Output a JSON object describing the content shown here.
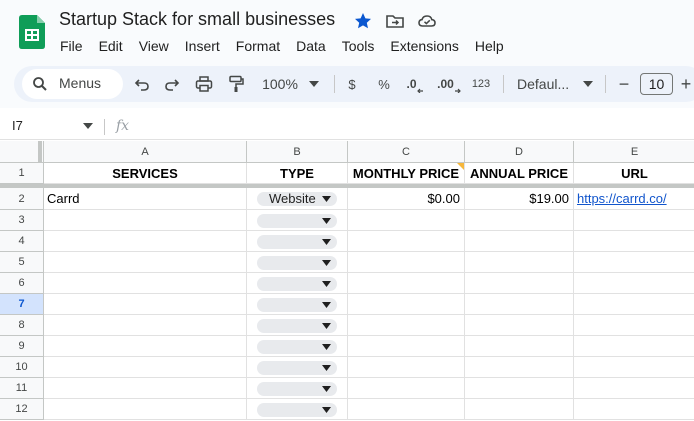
{
  "window": {
    "title": "Startup Stack for small businesses"
  },
  "menubar": {
    "items": [
      "File",
      "Edit",
      "View",
      "Insert",
      "Format",
      "Data",
      "Tools",
      "Extensions",
      "Help"
    ]
  },
  "toolbar": {
    "menus_label": "Menus",
    "zoom": "100%",
    "currency": "$",
    "percent": "%",
    "decrease_decimal": ".0",
    "increase_decimal": ".00",
    "number_format": "123",
    "font": "Defaul...",
    "font_size": "10",
    "minus": "−",
    "plus": "+"
  },
  "formula_bar": {
    "name_box": "I7",
    "fx": "fx"
  },
  "sheet": {
    "selected_row": 7,
    "columns": [
      "A",
      "B",
      "C",
      "D",
      "E"
    ],
    "row_numbers": [
      "1",
      "2",
      "3",
      "4",
      "5",
      "6",
      "7",
      "8",
      "9",
      "10",
      "11",
      "12"
    ],
    "header_row": [
      "SERVICES",
      "TYPE",
      "MONTHLY PRICE",
      "ANNUAL PRICE",
      "URL"
    ],
    "data_rows": [
      {
        "service": "Carrd",
        "type": "Website",
        "monthly": "$0.00",
        "annual": "$19.00",
        "url": "https://carrd.co/"
      }
    ]
  },
  "colors": {
    "accent_star": "#0b57d0",
    "link": "#1155cc",
    "selected_row_bg": "#d3e3fd",
    "sheets_green": "#0f9d58"
  },
  "icons": [
    "sheets-logo-icon",
    "star-icon",
    "move-to-folder-icon",
    "cloud-saved-icon",
    "search-icon",
    "undo-icon",
    "redo-icon",
    "print-icon",
    "paint-format-icon",
    "dropdown-arrow-icon",
    "fx-icon"
  ]
}
